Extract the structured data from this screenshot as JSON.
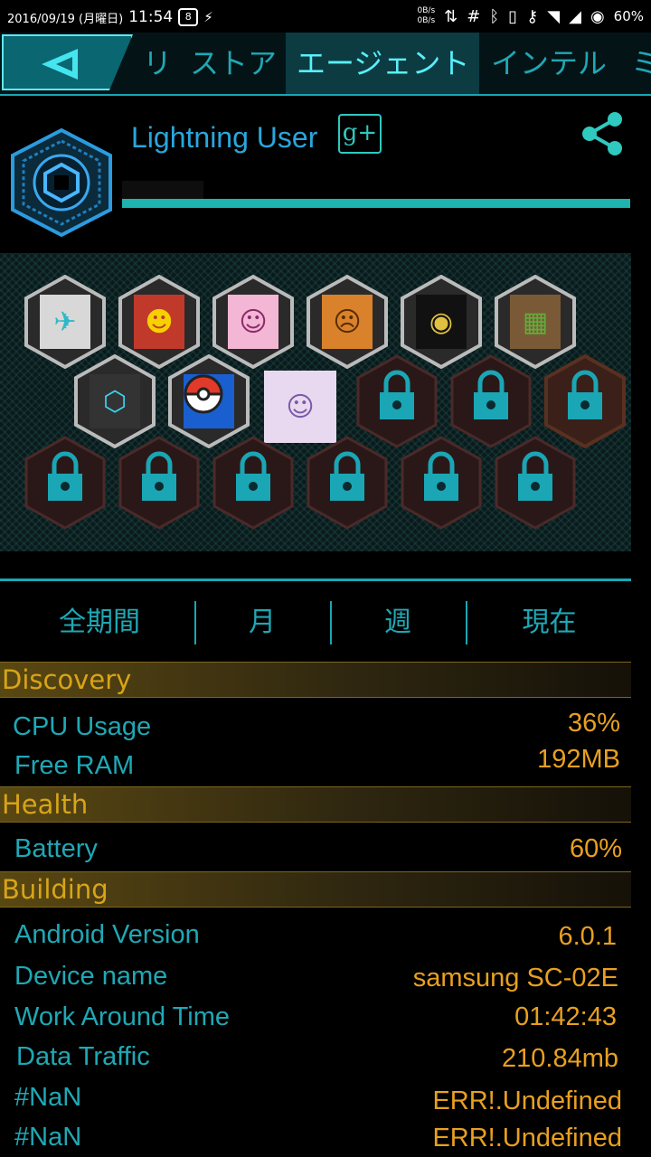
{
  "status_bar": {
    "date": "2016/09/19 (月曜日)",
    "time": "11:54",
    "notification_badge": "8",
    "net_up": "0B/s",
    "net_down": "0B/s",
    "battery": "60%"
  },
  "tabs": [
    {
      "label": "リ"
    },
    {
      "label": "ストア"
    },
    {
      "label": "エージェント",
      "active": true
    },
    {
      "label": "インテル"
    },
    {
      "label": "ミ"
    }
  ],
  "profile": {
    "username": "Lightning User",
    "gplus": "g+"
  },
  "badges": {
    "row1": [
      "aircraft",
      "monster",
      "anime-girl",
      "clash",
      "dark-figure",
      "minecraft"
    ],
    "row2": [
      "ingress",
      "pokeball",
      "anime-portrait",
      "locked",
      "locked",
      "locked"
    ],
    "row3": [
      "locked",
      "locked",
      "locked",
      "locked",
      "locked",
      "locked"
    ]
  },
  "periods": [
    "全期間",
    "月",
    "週",
    "現在"
  ],
  "sections": {
    "discovery": {
      "title": "Discovery",
      "rows": [
        {
          "label": "CPU Usage",
          "value": "36%"
        },
        {
          "label": "Free RAM",
          "value": "192MB"
        }
      ]
    },
    "health": {
      "title": "Health",
      "rows": [
        {
          "label": "Battery",
          "value": "60%"
        }
      ]
    },
    "building": {
      "title": "Building",
      "rows": [
        {
          "label": "Android Version",
          "value": "6.0.1"
        },
        {
          "label": "Device name",
          "value": "samsung SC-02E"
        },
        {
          "label": "Work Around Time",
          "value": "01:42:43"
        },
        {
          "label": "Data Traffic",
          "value": "210.84mb"
        },
        {
          "label": "#NaN",
          "value": "ERR!.Undefined"
        },
        {
          "label": "#NaN",
          "value": "ERR!.Undefined"
        }
      ]
    }
  },
  "colors": {
    "accent": "#1aa6b4",
    "value": "#e8a020",
    "section": "#d8a418"
  }
}
